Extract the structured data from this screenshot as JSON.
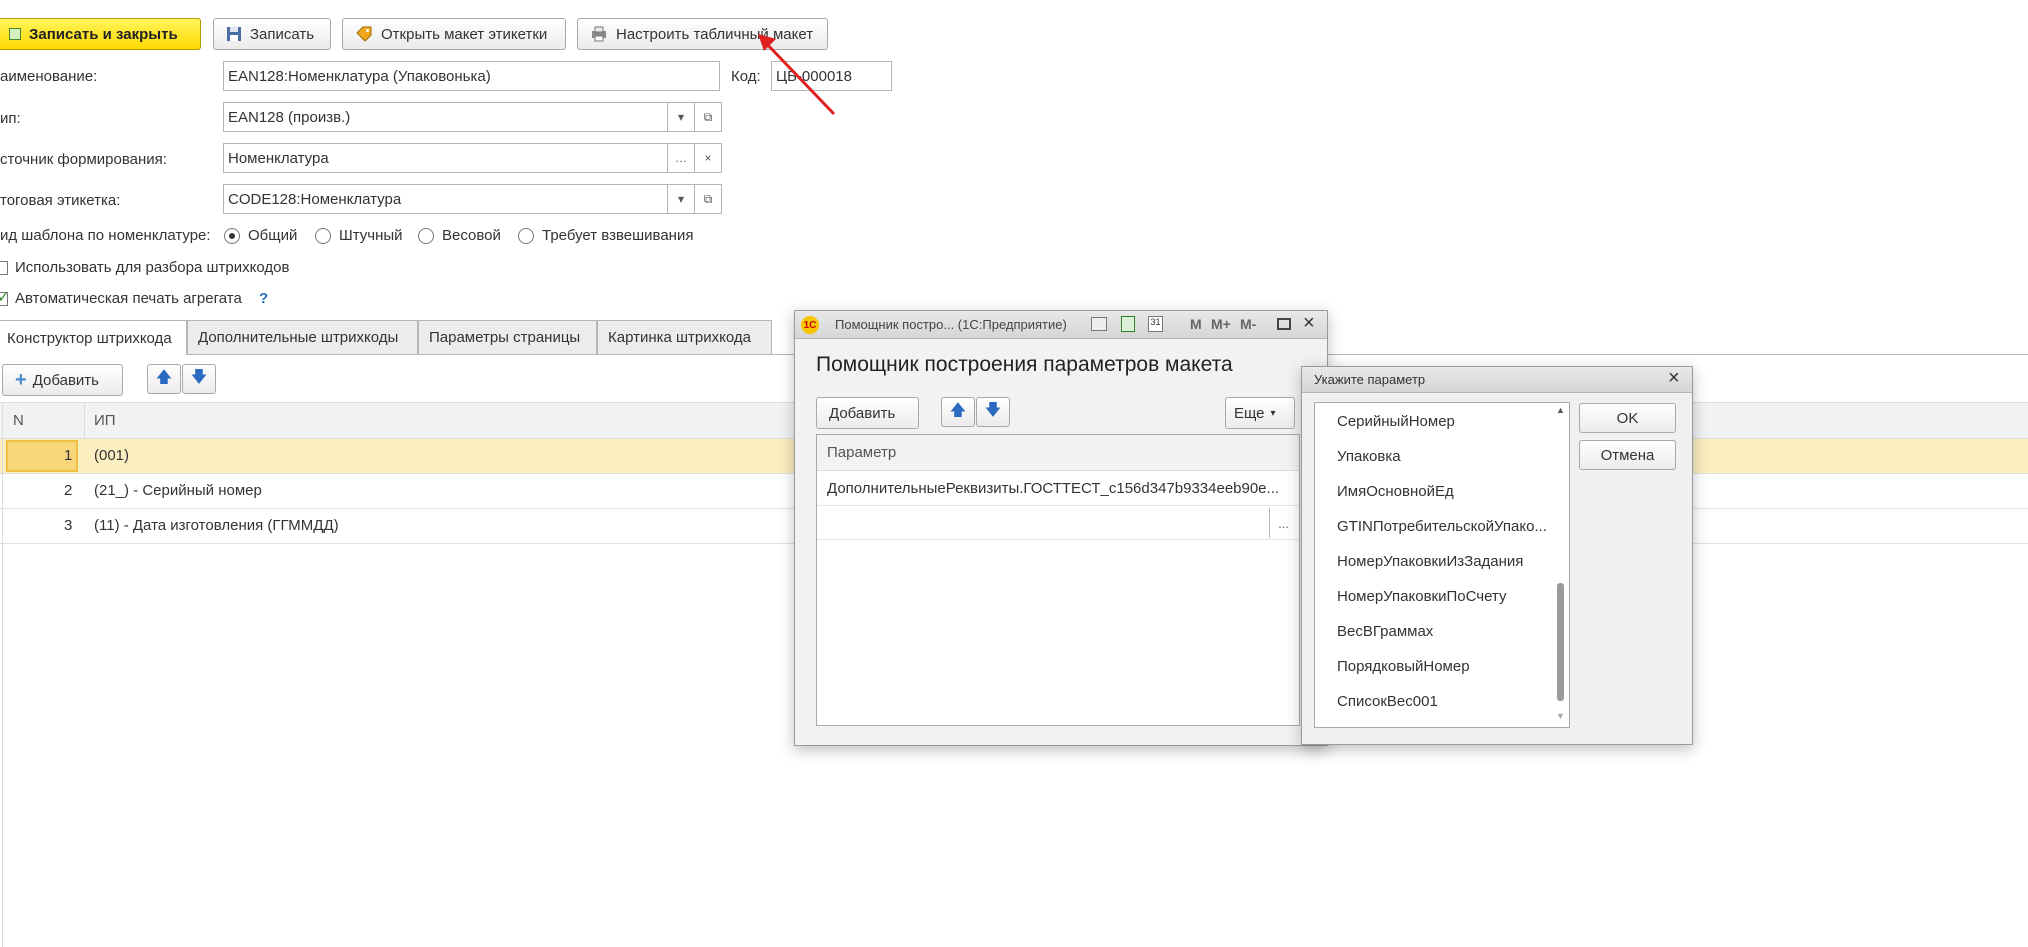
{
  "toolbar": {
    "save_close": "Записать и закрыть",
    "save": "Записать",
    "open_layout": "Открыть макет этикетки",
    "configure_table": "Настроить табличный макет"
  },
  "form": {
    "name_label": "аименование:",
    "name_value": "EAN128:Номенклатура (Упаковонька)",
    "code_label": "Код:",
    "code_value": "ЦБ-000018",
    "type_label": "ип:",
    "type_value": "EAN128 (произв.)",
    "source_label": "сточник формирования:",
    "source_value": "Номенклатура",
    "final_label": "тоговая этикетка:",
    "final_value": "CODE128:Номенклатура",
    "template_kind_label": "ид шаблона по номенклатуре:",
    "radio_options": [
      "Общий",
      "Штучный",
      "Весовой",
      "Требует взвешивания"
    ],
    "use_parse_label": "Использовать для разбора штрихкодов",
    "auto_print_label": "Автоматическая печать агрегата",
    "help_mark": "?"
  },
  "tabs": [
    "Конструктор штрихкода",
    "Дополнительные штрихкоды",
    "Параметры страницы",
    "Картинка штрихкода"
  ],
  "table": {
    "add_label": "Добавить",
    "columns": [
      "N",
      "ИП"
    ],
    "rows": [
      {
        "n": "1",
        "ip": "(001)"
      },
      {
        "n": "2",
        "ip": "(21_) - Серийный номер"
      },
      {
        "n": "3",
        "ip": "(11) - Дата изготовления (ГГММДД)"
      }
    ]
  },
  "helper_window": {
    "title": "Помощник постро... (1С:Предприятие)",
    "titlebar_icons": [
      "M",
      "M+",
      "M-"
    ],
    "heading": "Помощник построения параметров макета",
    "add_label": "Добавить",
    "more_label": "Еще",
    "column_header": "Параметр",
    "row_value": "ДополнительныеРеквизиты.ГОСТТЕСТ_c156d347b9334eeb90e...",
    "ellipsis": "..."
  },
  "param_dialog": {
    "title": "Укажите параметр",
    "items": [
      "СерийныйНомер",
      "Упаковка",
      "ИмяОсновнойЕд",
      "GTINПотребительскойУпако...",
      "НомерУпаковкиИзЗадания",
      "НомерУпаковкиПоСчету",
      "ВесВГраммах",
      "ПорядковыйНомер",
      "СписокВес001"
    ],
    "ok_label": "OK",
    "cancel_label": "Отмена"
  },
  "colors": {
    "primary_button": "#ffd900",
    "selected_row": "#fbeec0",
    "annotation_arrow": "#e02020"
  }
}
